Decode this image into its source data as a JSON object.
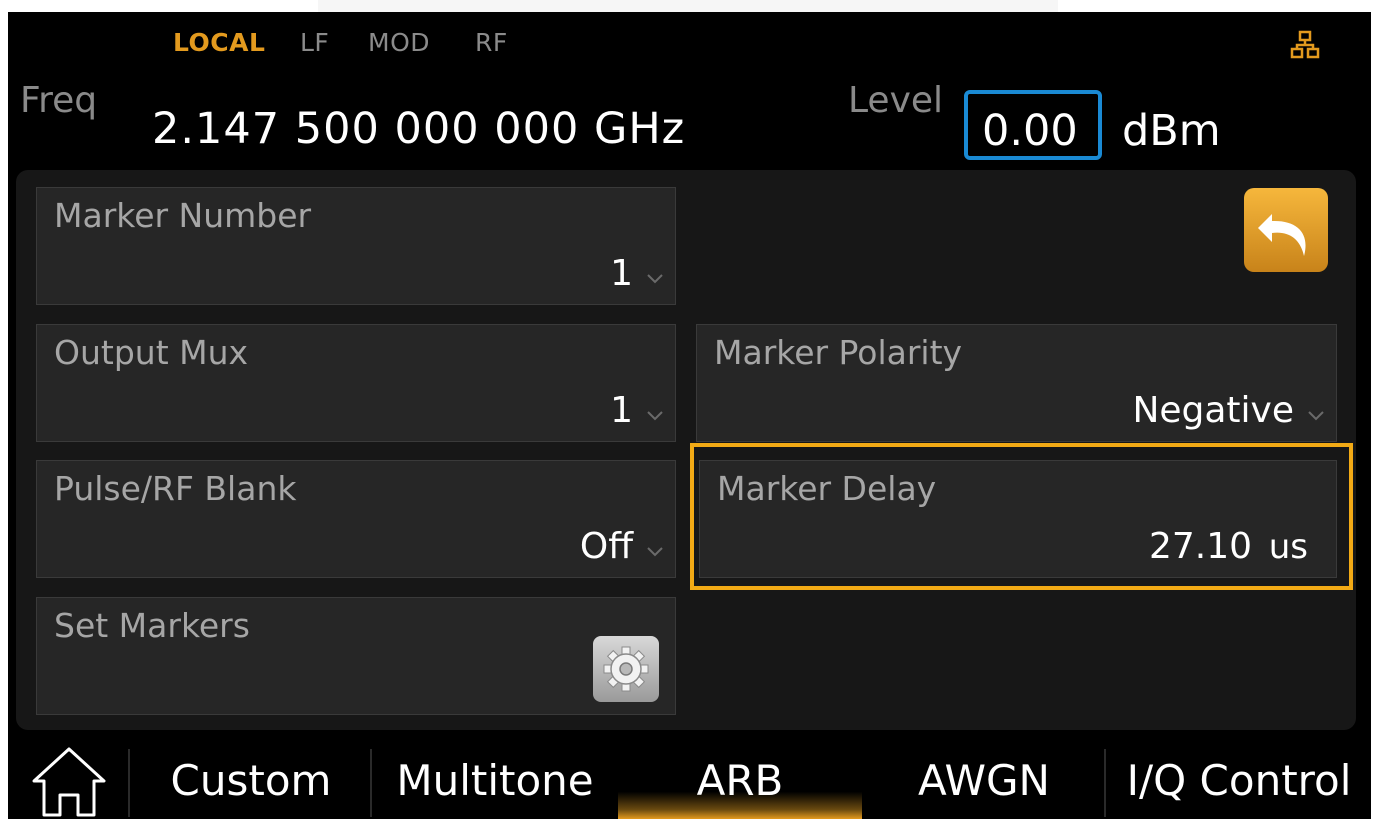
{
  "status_bar": {
    "local": "LOCAL",
    "lf": "LF",
    "mod": "MOD",
    "rf": "RF",
    "network_icon": "network-icon"
  },
  "freq": {
    "label": "Freq",
    "value": "2.147 500 000 000",
    "unit": "GHz"
  },
  "level": {
    "label": "Level",
    "value": "0.00",
    "unit": "dBm"
  },
  "fields": {
    "marker_number": {
      "label": "Marker Number",
      "value": "1"
    },
    "output_mux": {
      "label": "Output Mux",
      "value": "1"
    },
    "pulse_rf_blank": {
      "label": "Pulse/RF Blank",
      "value": "Off"
    },
    "set_markers": {
      "label": "Set Markers",
      "icon": "gear-icon"
    },
    "marker_polarity": {
      "label": "Marker Polarity",
      "value": "Negative"
    },
    "marker_delay": {
      "label": "Marker Delay",
      "value": "27.10",
      "unit": "us"
    }
  },
  "back_button": {
    "icon": "back-arrow-icon"
  },
  "tabs": {
    "home_icon": "home-icon",
    "items": [
      {
        "label": "Custom"
      },
      {
        "label": "Multitone"
      },
      {
        "label": "ARB"
      },
      {
        "label": "AWGN"
      },
      {
        "label": "I/Q Control"
      }
    ],
    "active": "ARB"
  },
  "colors": {
    "accent_orange": "#e39a1e",
    "highlight_yellow": "#f2aa15",
    "level_box_blue": "#1a8ad4"
  }
}
